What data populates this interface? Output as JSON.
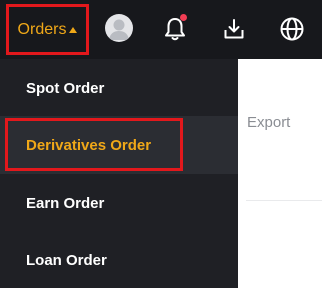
{
  "topbar": {
    "orders_label": "Orders",
    "icons": [
      "avatar",
      "bell-icon",
      "download-icon",
      "globe-icon"
    ],
    "accent_color": "#f0a818",
    "notification_dot_color": "#f23d54"
  },
  "menu": {
    "items": [
      {
        "label": "Spot Order"
      },
      {
        "label": "Derivatives Order",
        "selected": true
      },
      {
        "label": "Earn Order"
      },
      {
        "label": "Loan Order"
      }
    ]
  },
  "background_page": {
    "export_label": "Export"
  },
  "highlight_color": "#e2181c"
}
